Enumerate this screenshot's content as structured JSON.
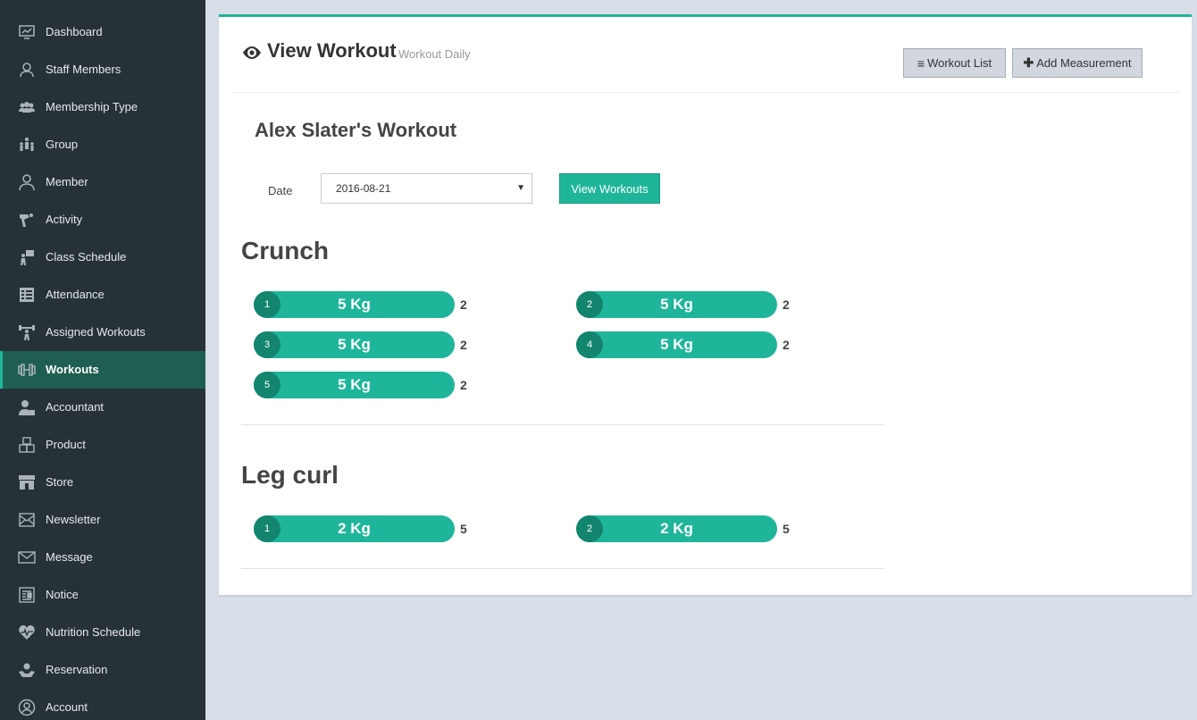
{
  "sidebar": {
    "items": [
      {
        "label": "Dashboard",
        "icon": "dashboard-icon"
      },
      {
        "label": "Staff Members",
        "icon": "staff-icon"
      },
      {
        "label": "Membership Type",
        "icon": "membership-icon"
      },
      {
        "label": "Group",
        "icon": "group-icon"
      },
      {
        "label": "Member",
        "icon": "member-icon"
      },
      {
        "label": "Activity",
        "icon": "activity-icon"
      },
      {
        "label": "Class Schedule",
        "icon": "class-schedule-icon"
      },
      {
        "label": "Attendance",
        "icon": "attendance-icon"
      },
      {
        "label": "Assigned Workouts",
        "icon": "assigned-workouts-icon"
      },
      {
        "label": "Workouts",
        "icon": "dumbbell-icon",
        "active": true
      },
      {
        "label": "Accountant",
        "icon": "accountant-icon"
      },
      {
        "label": "Product",
        "icon": "product-icon"
      },
      {
        "label": "Store",
        "icon": "store-icon"
      },
      {
        "label": "Newsletter",
        "icon": "newsletter-icon"
      },
      {
        "label": "Message",
        "icon": "message-icon"
      },
      {
        "label": "Notice",
        "icon": "notice-icon"
      },
      {
        "label": "Nutrition Schedule",
        "icon": "nutrition-icon"
      },
      {
        "label": "Reservation",
        "icon": "reservation-icon"
      },
      {
        "label": "Account",
        "icon": "account-icon"
      }
    ]
  },
  "header": {
    "title": "View Workout",
    "subtitle": "Workout Daily",
    "title_icon": "eye-icon",
    "workout_list_label": "Workout List",
    "workout_list_icon": "list-icon",
    "add_measurement_label": "Add Measurement",
    "add_measurement_icon": "plus-icon"
  },
  "content": {
    "person_title": "Alex Slater's Workout",
    "date_label": "Date",
    "date_value": "2016-08-21",
    "view_button": "View Workouts",
    "exercises": [
      {
        "name": "Crunch",
        "sets": [
          {
            "num": "1",
            "weight": "5 Kg",
            "reps": "2"
          },
          {
            "num": "2",
            "weight": "5 Kg",
            "reps": "2"
          },
          {
            "num": "3",
            "weight": "5 Kg",
            "reps": "2"
          },
          {
            "num": "4",
            "weight": "5 Kg",
            "reps": "2"
          },
          {
            "num": "5",
            "weight": "5 Kg",
            "reps": "2"
          }
        ]
      },
      {
        "name": "Leg curl",
        "sets": [
          {
            "num": "1",
            "weight": "2 Kg",
            "reps": "5"
          },
          {
            "num": "2",
            "weight": "2 Kg",
            "reps": "5"
          }
        ]
      }
    ]
  },
  "colors": {
    "sidebar_bg": "#263238",
    "sidebar_active": "#1e5f52",
    "accent": "#1fb59a",
    "accent_dark": "#13856f",
    "page_bg": "#d8dee7"
  }
}
